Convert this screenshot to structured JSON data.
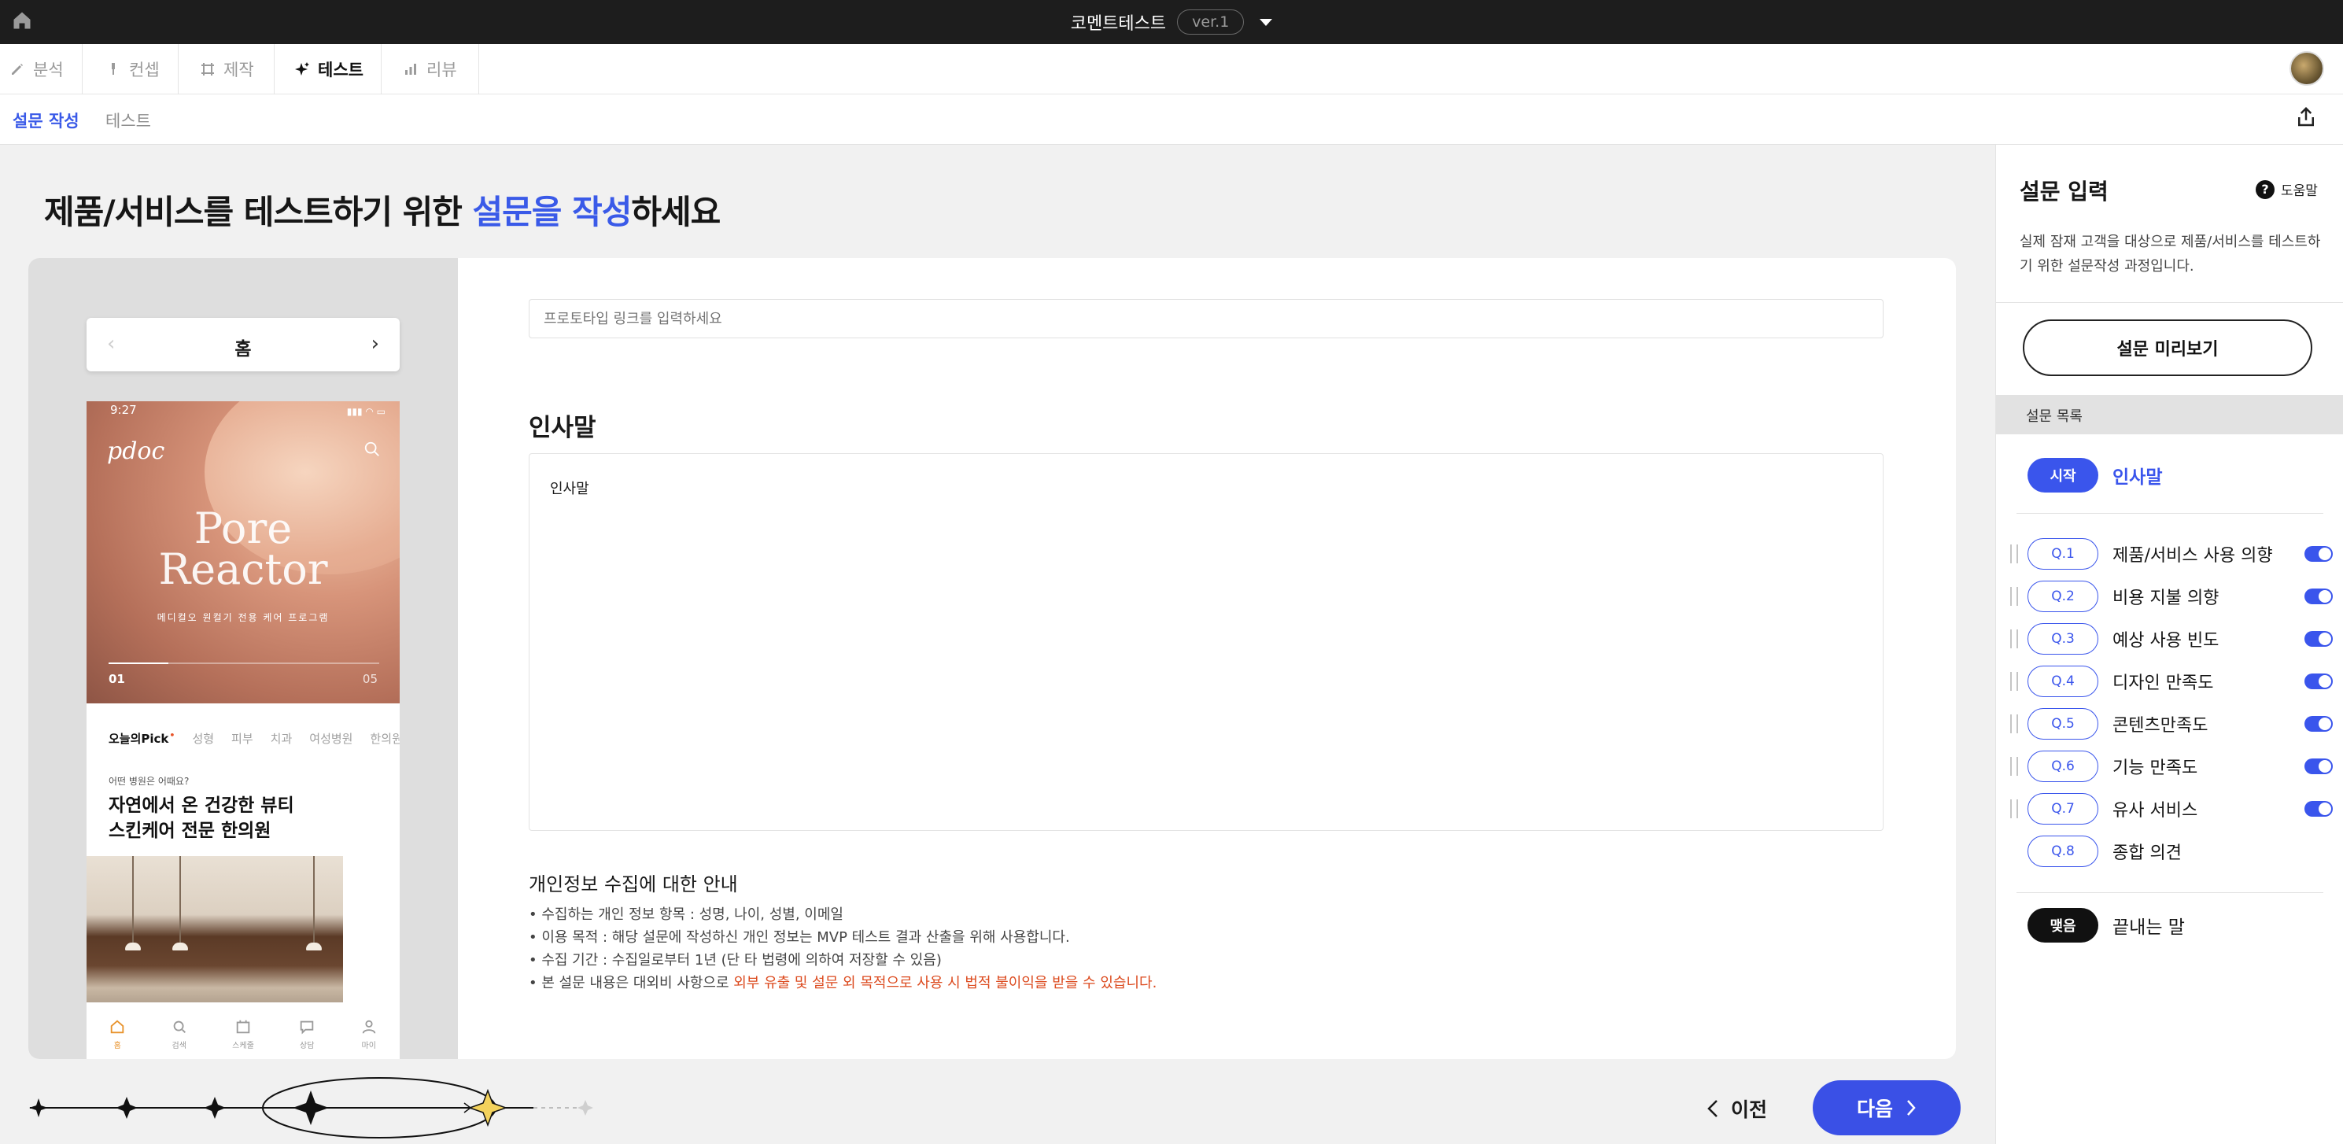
{
  "topbar": {
    "title": "코멘트테스트",
    "version": "ver.1"
  },
  "nav": {
    "tabs": [
      {
        "label": "분석"
      },
      {
        "label": "컨셉"
      },
      {
        "label": "제작"
      },
      {
        "label": "테스트"
      },
      {
        "label": "리뷰"
      }
    ]
  },
  "subnav": {
    "tabs": [
      {
        "label": "설문 작성"
      },
      {
        "label": "테스트"
      }
    ]
  },
  "main": {
    "heading_pre": "제품/서비스를 테스트하기 위한 ",
    "heading_highlight": "설문을 작성",
    "heading_post": "하세요",
    "link_placeholder": "프로토타입 링크를 입력하세요",
    "greeting_title": "인사말",
    "greeting_text": "인사말",
    "privacy_title": "개인정보 수집에 대한 안내",
    "privacy_items": [
      "• 수집하는 개인 정보 항목 : 성명, 나이, 성별, 이메일",
      "• 이용 목적 : 해당 설문에 작성하신 개인 정보는 MVP 테스트 결과 산출을 위해 사용합니다.",
      "• 수집 기간 : 수집일로부터 1년 (단 타 법령에 의하여 저장할 수 있음)"
    ],
    "privacy_last_pre": "• 본 설문 내용은 대외비 사항으로 ",
    "privacy_last_warn": "외부 유출 및 설문 외 목적으로 사용 시 법적 불이익을 받을 수 있습니다."
  },
  "preview": {
    "pager_label": "홈",
    "status_time": "9:27",
    "brand": "pdoc",
    "hero_title_1": "Pore",
    "hero_title_2": "Reactor",
    "hero_sub": "메디컬오 원컬기 전용 케어 프로그램",
    "hero_index": "01",
    "hero_total": "05",
    "categories": [
      "오늘의Pick",
      "성형",
      "피부",
      "치과",
      "여성병원",
      "한의원"
    ],
    "ask": "어떤 병원은 어때요?",
    "promo_line1": "자연에서 온 건강한 뷰티",
    "promo_line2": "스킨케어 전문 한의원",
    "bottom_nav": [
      "홈",
      "검색",
      "스케줄",
      "상담",
      "마이"
    ]
  },
  "footer": {
    "prev_label": "이전",
    "next_label": "다음"
  },
  "sidebar": {
    "title": "설문 입력",
    "help_label": "도움말",
    "description": "실제 잠재 고객을 대상으로 제품/서비스를 테스트하기 위한 설문작성 과정입니다.",
    "preview_button": "설문 미리보기",
    "list_header": "설문 목록",
    "start_pill": "시작",
    "start_label": "인사말",
    "questions": [
      {
        "tag": "Q.1",
        "label": "제품/서비스 사용 의향",
        "enabled": true
      },
      {
        "tag": "Q.2",
        "label": "비용 지불 의향",
        "enabled": true
      },
      {
        "tag": "Q.3",
        "label": "예상 사용 빈도",
        "enabled": true
      },
      {
        "tag": "Q.4",
        "label": "디자인 만족도",
        "enabled": true
      },
      {
        "tag": "Q.5",
        "label": "콘텐츠만족도",
        "enabled": true
      },
      {
        "tag": "Q.6",
        "label": "기능 만족도",
        "enabled": true
      },
      {
        "tag": "Q.7",
        "label": "유사 서비스",
        "enabled": true
      },
      {
        "tag": "Q.8",
        "label": "종합 의견",
        "enabled": false
      }
    ],
    "end_pill": "맺음",
    "end_label": "끝내는 말"
  },
  "colors": {
    "accent": "#3a55ec",
    "warning": "#dc4a1e",
    "topbar": "#1d1d1d",
    "progress_star": "#f3d25c"
  }
}
